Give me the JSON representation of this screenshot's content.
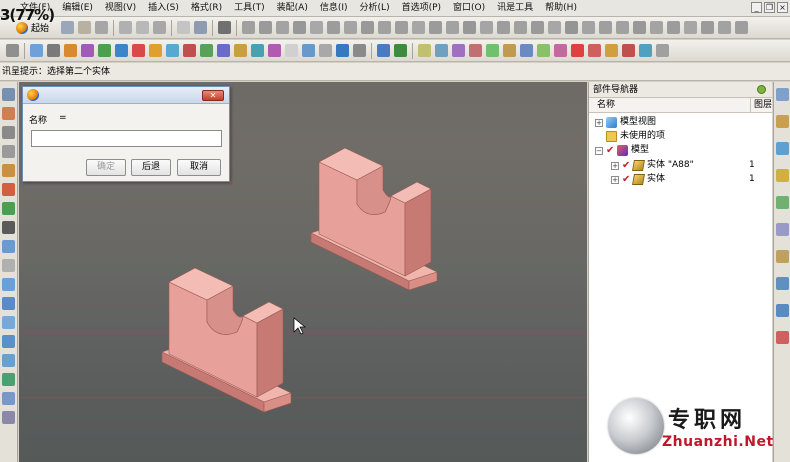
{
  "app": {
    "zoom_text": "3(77%)"
  },
  "menu": [
    "文件(F)",
    "编辑(E)",
    "视图(V)",
    "插入(S)",
    "格式(R)",
    "工具(T)",
    "装配(A)",
    "信息(I)",
    "分析(L)",
    "首选项(P)",
    "窗口(O)",
    "讯是工具",
    "帮助(H)"
  ],
  "toolbar": {
    "start_label": "起始"
  },
  "cue_line": "讯呈提示：选择第二个实体",
  "dialog": {
    "name_label": "名称",
    "equals": "=",
    "name_value": "",
    "ok_label": "确定",
    "back_label": "后退",
    "cancel_label": "取消"
  },
  "navigator": {
    "title": "部件导航器",
    "col_name": "名称",
    "col_map": "图层",
    "items": [
      {
        "label": "模型视图",
        "count": ""
      },
      {
        "label": "未使用的项",
        "count": ""
      },
      {
        "label": "模型",
        "count": ""
      },
      {
        "label": "实体 \"A88\"",
        "count": "1"
      },
      {
        "label": "实体",
        "count": "1"
      }
    ]
  },
  "watermark": {
    "cn": "专职网",
    "en": "Zhuanzhi.Net"
  },
  "colors": {
    "part_face": "#e8a09a",
    "part_side": "#c77a74",
    "part_top": "#f0b6ae",
    "dialog_border": "#6f8fb8"
  }
}
